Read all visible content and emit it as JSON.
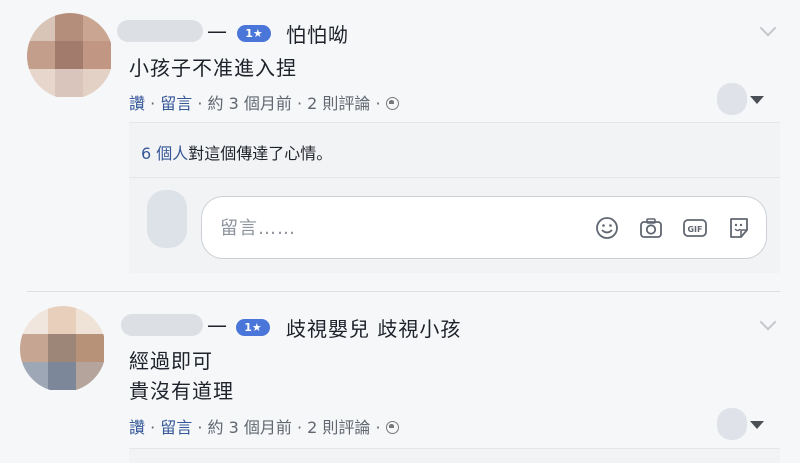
{
  "posts": [
    {
      "badge": "1★",
      "relation": "怕怕呦",
      "message_lines": [
        "小孩子不准進入捏"
      ],
      "actions": {
        "read": "讚",
        "dot1": " · ",
        "comment": "留言",
        "meta": " · 約 3 個月前 · 2 則評論 · "
      },
      "reactions": {
        "count_link": "6 個人",
        "text": "對這個傳達了心情。"
      },
      "comment_placeholder": "留言……",
      "dash": "—"
    },
    {
      "badge": "1★",
      "relation": "歧視嬰兒 歧視小孩",
      "message_lines": [
        "經過即可",
        "貴沒有道理"
      ],
      "actions": {
        "read": "讚",
        "dot1": " · ",
        "comment": "留言",
        "meta": " · 約 3 個月前 · 2 則評論 · "
      },
      "dash": "—"
    }
  ],
  "icons": [
    "emoji-icon",
    "camera-icon",
    "gif-icon",
    "sticker-icon",
    "globe-icon",
    "chevron-down-icon"
  ],
  "colors": {
    "link": "#365899",
    "badge": "#4a76d9",
    "background": "#f6f7f9"
  }
}
